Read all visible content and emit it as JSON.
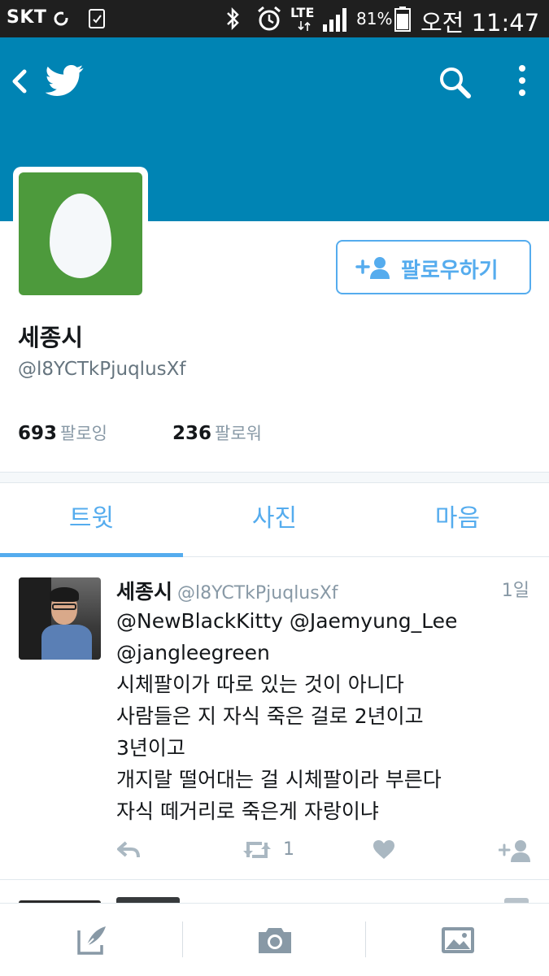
{
  "status_bar": {
    "carrier": "SKT",
    "battery_percent": "81%",
    "network": "LTE",
    "clock": "오전 11:47",
    "icons": [
      "sync-icon",
      "screenshot-icon",
      "bluetooth-icon",
      "alarm-icon",
      "lte-icon",
      "signal-icon",
      "battery-icon"
    ]
  },
  "header": {
    "background_color": "#0084b4",
    "icons": [
      "back-icon",
      "twitter-logo",
      "search-icon",
      "more-icon"
    ]
  },
  "profile": {
    "name": "세종시",
    "handle": "@l8YCTkPjuqlusXf",
    "avatar": "default-egg-avatar",
    "avatar_color": "#4d9a3c",
    "follow_button_label": "팔로우하기",
    "following_count": "693",
    "following_label": "팔로잉",
    "followers_count": "236",
    "followers_label": "팔로워"
  },
  "tabs": [
    {
      "label": "트윗",
      "selected": true
    },
    {
      "label": "사진",
      "selected": false
    },
    {
      "label": "마음",
      "selected": false
    }
  ],
  "tweet": {
    "name": "세종시",
    "handle": "@l8YCTkPjuqlusXf",
    "time": "1일",
    "lines": [
      "@NewBlackKitty @Jaemyung_Lee",
      "@jangleegreen",
      "시체팔이가 따로 있는 것이 아니다",
      "사람들은 지 자식 죽은 걸로 2년이고",
      "3년이고",
      "개지랄 떨어대는 걸 시체팔이라 부른다",
      "자식 떼거리로 죽은게 자랑이냐"
    ],
    "retweet_count": "1",
    "actions": [
      "reply-icon",
      "retweet-icon",
      "like-icon",
      "follow-icon"
    ]
  },
  "bottom_bar": {
    "items": [
      "compose-tweet-icon",
      "camera-icon",
      "gallery-icon"
    ]
  },
  "accent_color": "#55acee"
}
